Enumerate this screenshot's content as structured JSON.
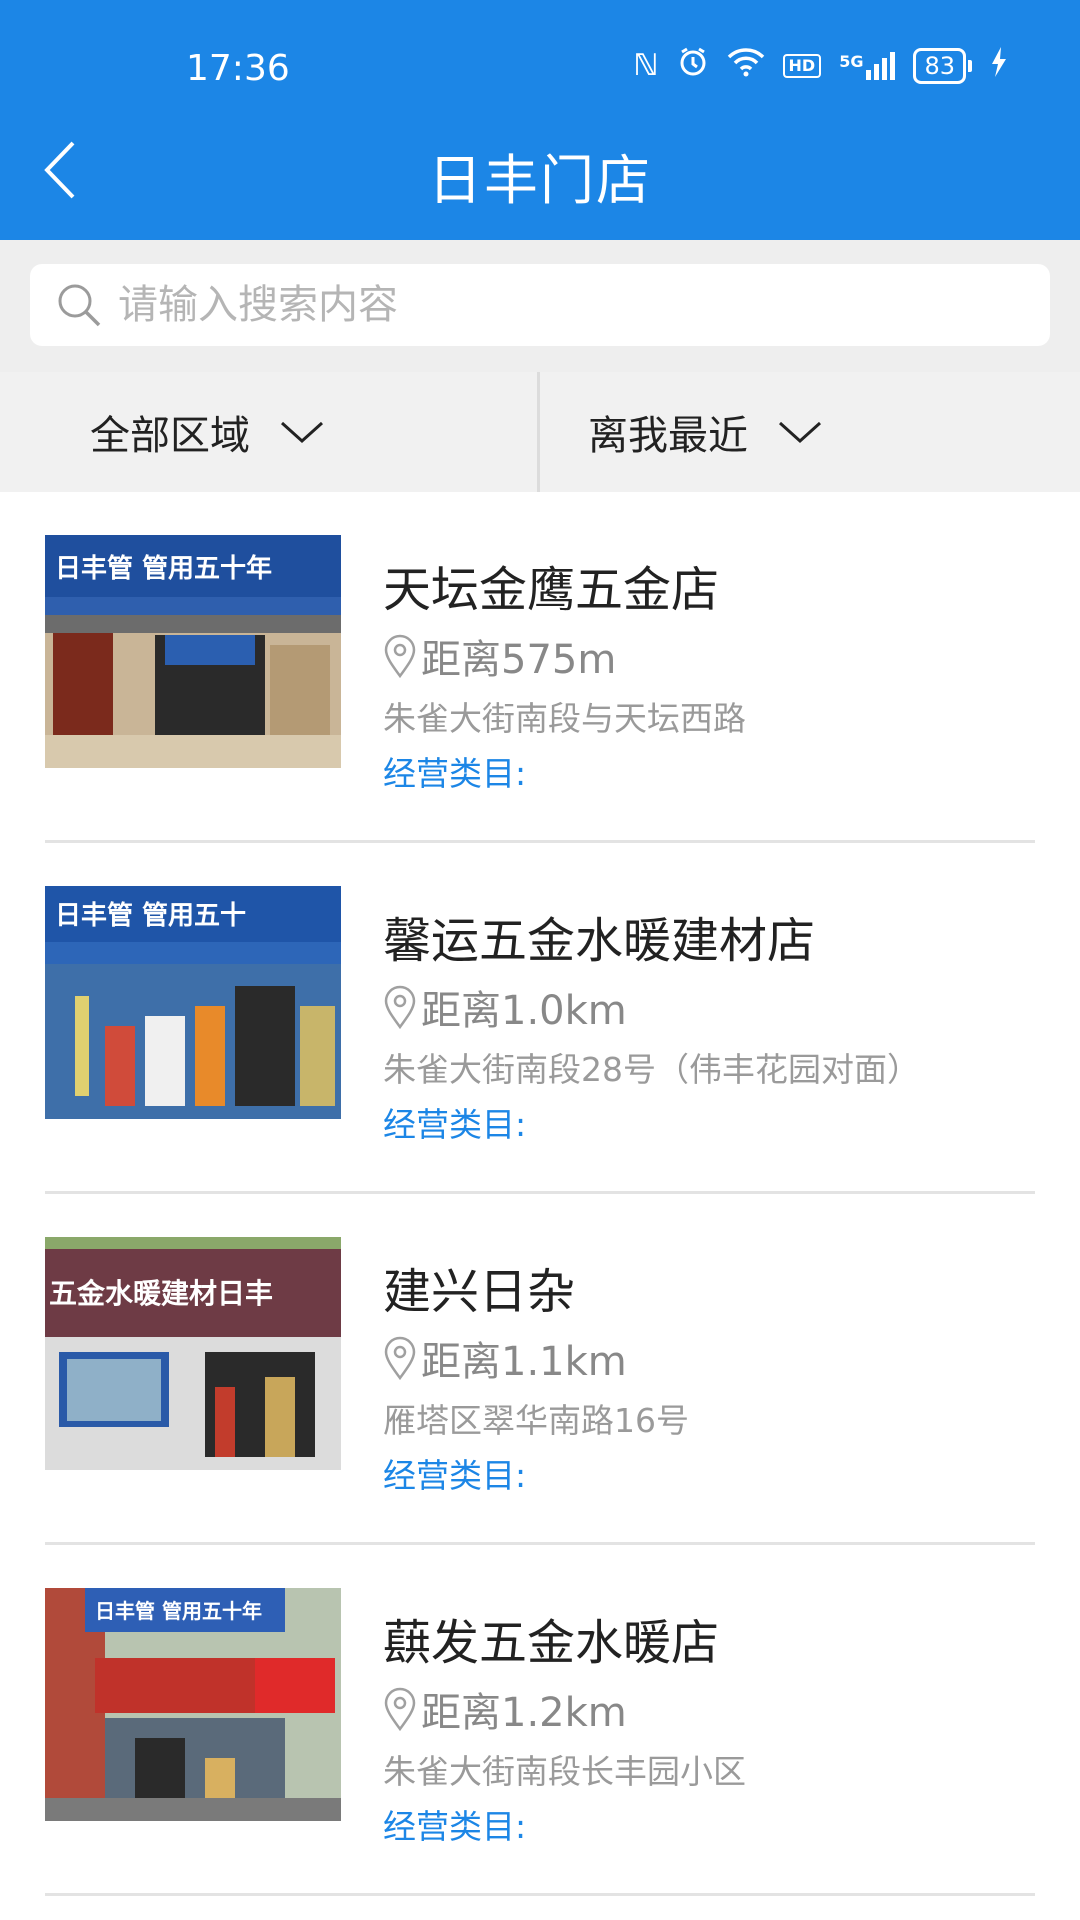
{
  "status_bar": {
    "time": "17:36",
    "network": "5G",
    "hd": "HD",
    "nfc": "N",
    "battery": "83"
  },
  "header": {
    "title": "日丰门店"
  },
  "search": {
    "placeholder": "请输入搜索内容"
  },
  "filters": {
    "region": "全部区域",
    "sort": "离我最近"
  },
  "stores": [
    {
      "name": "天坛金鹰五金店",
      "distance": "距离575m",
      "address": "朱雀大街南段与天坛西路",
      "category_label": "经营类目:",
      "sign_text": "日丰管 管用五十年"
    },
    {
      "name": "馨运五金水暖建材店",
      "distance": "距离1.0km",
      "address": "朱雀大街南段28号（伟丰花园对面）",
      "category_label": "经营类目:",
      "sign_text": "日丰管 管用五十"
    },
    {
      "name": "建兴日杂",
      "distance": "距离1.1km",
      "address": "雁塔区翠华南路16号",
      "category_label": "经营类目:",
      "sign_text": "五金水暖建材日丰"
    },
    {
      "name": "蕻发五金水暖店",
      "distance": "距离1.2km",
      "address": "朱雀大街南段长丰园小区",
      "category_label": "经营类目:",
      "sign_text": "日丰管 管用五十年"
    }
  ],
  "colors": {
    "primary": "#1c86e6",
    "background": "#ffffff",
    "filter_bg": "#f1f1f1"
  },
  "icons": [
    "chevron-left-icon",
    "search-icon",
    "chevron-down-icon",
    "location-pin-icon",
    "nfc-icon",
    "alarm-icon",
    "wifi-icon",
    "signal-icon",
    "battery-icon",
    "charging-icon"
  ]
}
